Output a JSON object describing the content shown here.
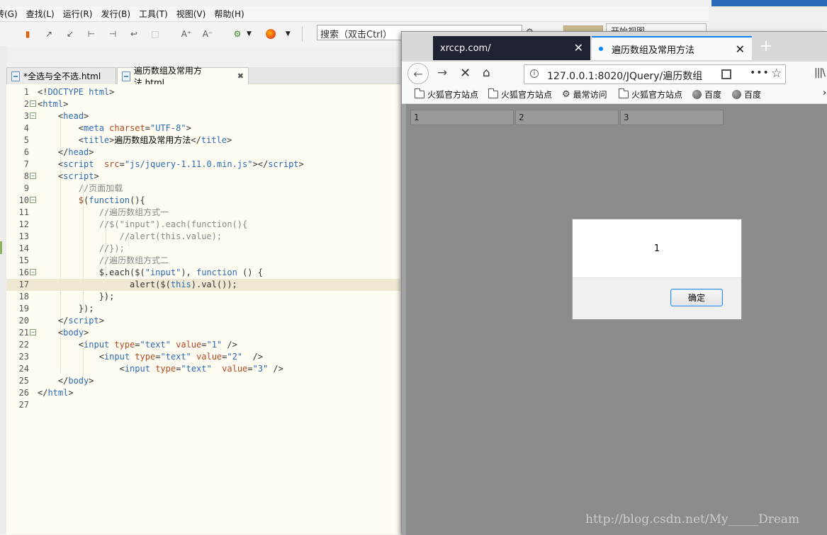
{
  "ide": {
    "menu": [
      "转(G)",
      "查找(L)",
      "运行(R)",
      "发行(B)",
      "工具(T)",
      "视图(V)",
      "帮助(H)"
    ],
    "search_placeholder": "搜索（双击Ctrl）",
    "right_button": "开始视图",
    "tabs": [
      {
        "label": "*全选与全不选.html",
        "active": false
      },
      {
        "label": "遍历数组及常用方法.html",
        "active": true
      }
    ],
    "editor": {
      "highlighted_line": 17,
      "lines": [
        {
          "n": "1"
        },
        {
          "n": "2"
        },
        {
          "n": "3"
        },
        {
          "n": "4"
        },
        {
          "n": "5"
        },
        {
          "n": "6"
        },
        {
          "n": "7"
        },
        {
          "n": "8"
        },
        {
          "n": "9"
        },
        {
          "n": "10"
        },
        {
          "n": "11"
        },
        {
          "n": "12"
        },
        {
          "n": "13"
        },
        {
          "n": "14"
        },
        {
          "n": "15"
        },
        {
          "n": "16"
        },
        {
          "n": "17"
        },
        {
          "n": "18"
        },
        {
          "n": "19"
        },
        {
          "n": "20"
        },
        {
          "n": "21"
        },
        {
          "n": "22"
        },
        {
          "n": "23"
        },
        {
          "n": "24"
        },
        {
          "n": "25"
        },
        {
          "n": "26"
        },
        {
          "n": "27"
        }
      ],
      "text": {
        "doctype": "DOCTYPE html",
        "html": "html",
        "head": "head",
        "meta": "meta",
        "charset_attr": "charset",
        "charset_val": "\"UTF-8\"",
        "title_tag": "title",
        "title_text": "遍历数组及常用方法",
        "script": "script",
        "src_attr": "src",
        "src_val": "\"js/jquery-1.11.0.min.js\"",
        "c_page_load": "//页面加载",
        "function_kw": "function",
        "c_way1": "//遍历数组方式一",
        "c_l12": "//$(\"input\").each(function(){",
        "c_l13": "//alert(this.value);",
        "c_l14": "//});",
        "c_way2": "//遍历数组方式二",
        "l16_a": "$.each($(",
        "l16_str": "\"input\"",
        "l16_b": "), ",
        "l16_c": "() {",
        "l17_a": "alert($(",
        "this_kw": "this",
        "l17_b": ").val());",
        "l18": "});",
        "l19": "});",
        "body": "body",
        "input": "input",
        "type_attr": "type",
        "type_val": "\"text\"",
        "value_attr": "value",
        "v1": "\"1\"",
        "v2": "\"2\"",
        "v3": "\"3\""
      }
    }
  },
  "browser": {
    "tabs": [
      {
        "label": "xrccp.com/"
      },
      {
        "label": "遍历数组及常用方法"
      }
    ],
    "url": "127.0.0.1:8020/JQuery/遍历数组",
    "bookmarks": [
      {
        "label": "火狐官方站点",
        "icon": "folder-icon"
      },
      {
        "label": "火狐官方站点",
        "icon": "folder-icon"
      },
      {
        "label": "最常访问",
        "icon": "gear-icon"
      },
      {
        "label": "火狐官方站点",
        "icon": "folder-icon"
      },
      {
        "label": "百度",
        "icon": "globe-icon"
      },
      {
        "label": "百度",
        "icon": "globe-icon"
      }
    ],
    "page_inputs": [
      "1",
      "2",
      "3"
    ],
    "alert": {
      "message": "1",
      "ok_label": "确定"
    }
  },
  "watermark": "http://blog.csdn.net/My_____Dream"
}
